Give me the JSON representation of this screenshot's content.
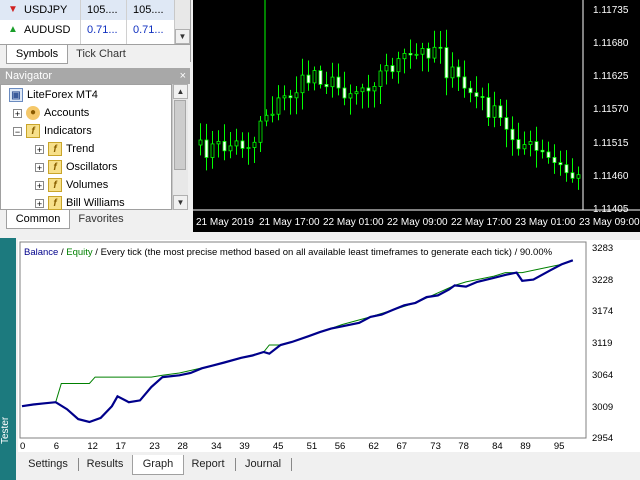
{
  "market_watch": {
    "rows": [
      {
        "symbol": "USDJPY",
        "bid": "105....",
        "ask": "105....",
        "direction": "down"
      },
      {
        "symbol": "AUDUSD",
        "bid": "0.71...",
        "ask": "0.71...",
        "direction": "up"
      }
    ],
    "tabs": [
      "Symbols",
      "Tick Chart"
    ],
    "active_tab": "Symbols"
  },
  "navigator": {
    "title": "Navigator",
    "close": "×",
    "root": "LiteForex MT4",
    "items": [
      {
        "label": "Accounts",
        "icon": "accounts-icon"
      },
      {
        "label": "Indicators",
        "icon": "indicators-icon"
      },
      {
        "label": "Trend",
        "icon": "indicator-folder-icon"
      },
      {
        "label": "Oscillators",
        "icon": "indicator-folder-icon"
      },
      {
        "label": "Volumes",
        "icon": "indicator-folder-icon"
      },
      {
        "label": "Bill Williams",
        "icon": "indicator-folder-icon"
      }
    ],
    "tabs": [
      "Common",
      "Favorites"
    ],
    "active_tab": "Common"
  },
  "price_chart": {
    "price_labels": [
      "1.11735",
      "1.11680",
      "1.11625",
      "1.11570",
      "1.11515",
      "1.11460",
      "1.11405"
    ],
    "time_labels": [
      "21 May 2019",
      "21 May 17:00",
      "22 May 01:00",
      "22 May 09:00",
      "22 May 17:00",
      "23 May 01:00",
      "23 May 09:00"
    ],
    "colors": {
      "background": "#000000",
      "candle": "#00ff00",
      "text": "#ffffff"
    }
  },
  "tester": {
    "side_label": "Tester",
    "legend": {
      "balance": "Balance",
      "sep": " / ",
      "equity": "Equity",
      "rest": " / Every tick (the most precise method based on all available least timeframes to generate each tick) / 90.00%"
    },
    "y_labels": [
      "3283",
      "3228",
      "3174",
      "3119",
      "3064",
      "3009",
      "2954"
    ],
    "x_labels": [
      "0",
      "6",
      "12",
      "17",
      "23",
      "28",
      "34",
      "39",
      "45",
      "51",
      "56",
      "62",
      "67",
      "73",
      "78",
      "84",
      "89",
      "95"
    ],
    "tabs": [
      "Settings",
      "Results",
      "Graph",
      "Report",
      "Journal"
    ],
    "active_tab": "Graph",
    "colors": {
      "balance": "#00008b",
      "equity": "#008000"
    }
  },
  "chart_data": {
    "type": "line",
    "title": "",
    "xlabel": "",
    "ylabel": "",
    "ylim": [
      2954,
      3283
    ],
    "xlim": [
      0,
      100
    ],
    "grid": false,
    "series": [
      {
        "name": "Balance",
        "x": [
          0,
          2,
          4,
          6,
          8,
          10,
          12,
          14,
          16,
          17,
          19,
          21,
          23,
          25,
          28,
          30,
          32,
          34,
          36,
          39,
          41,
          43,
          44,
          46,
          48,
          51,
          53,
          55,
          57,
          60,
          62,
          64,
          66,
          68,
          70,
          72,
          74,
          76,
          77,
          79,
          81,
          84,
          86,
          88,
          89,
          91,
          94,
          96,
          98
        ],
        "y": [
          3005,
          3008,
          3010,
          3012,
          3000,
          2983,
          2978,
          2985,
          3005,
          3022,
          3012,
          3015,
          3038,
          3055,
          3058,
          3062,
          3070,
          3075,
          3080,
          3088,
          3092,
          3098,
          3095,
          3110,
          3115,
          3125,
          3132,
          3138,
          3142,
          3148,
          3158,
          3162,
          3170,
          3178,
          3182,
          3192,
          3195,
          3205,
          3212,
          3210,
          3218,
          3225,
          3230,
          3234,
          3220,
          3222,
          3238,
          3248,
          3255
        ]
      },
      {
        "name": "Equity",
        "x": [
          0,
          6,
          7,
          12,
          13,
          17,
          23,
          25,
          28,
          34,
          39,
          43,
          44,
          46,
          48,
          51,
          57,
          62,
          70,
          77,
          79,
          84,
          86,
          89,
          91,
          96,
          98
        ],
        "y": [
          3005,
          3012,
          3044,
          3044,
          3055,
          3055,
          3055,
          3058,
          3062,
          3075,
          3088,
          3098,
          3110,
          3110,
          3115,
          3125,
          3145,
          3158,
          3182,
          3212,
          3218,
          3228,
          3234,
          3234,
          3238,
          3248,
          3255
        ]
      }
    ]
  }
}
